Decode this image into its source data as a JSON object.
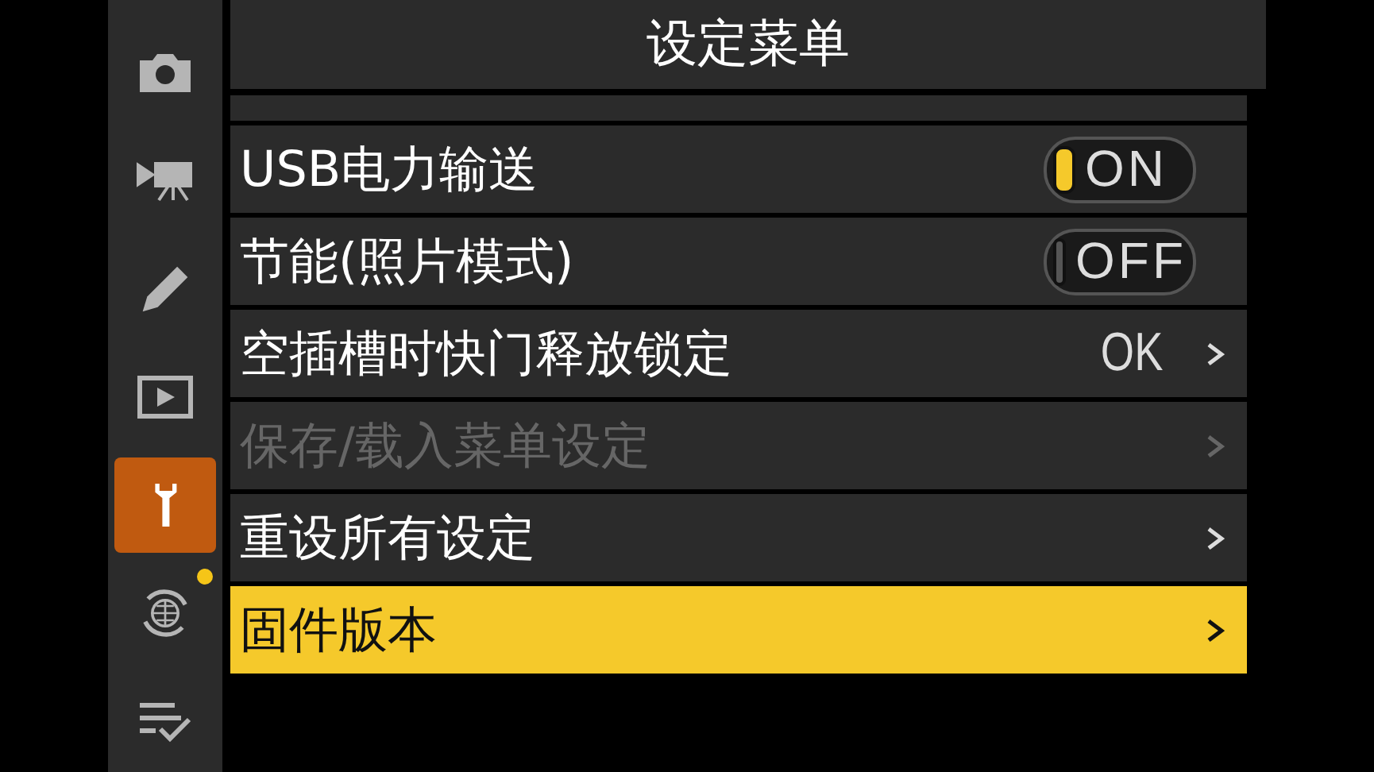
{
  "sidebar": {
    "items": [
      {
        "selected": false,
        "badge": false
      },
      {
        "selected": false,
        "badge": false
      },
      {
        "selected": false,
        "badge": false
      },
      {
        "selected": false,
        "badge": false
      },
      {
        "selected": true,
        "badge": false
      },
      {
        "selected": false,
        "badge": true
      },
      {
        "selected": false,
        "badge": false
      }
    ]
  },
  "title": "设定菜单",
  "menu": {
    "items": [
      {
        "kind": "toggle",
        "label": "USB电力输送",
        "value": "ON",
        "on": true,
        "disabled": false,
        "selected": false
      },
      {
        "kind": "toggle",
        "label": "节能(照片模式)",
        "value": "OFF",
        "on": false,
        "disabled": false,
        "selected": false
      },
      {
        "kind": "value",
        "label": "空插槽时快门释放锁定",
        "value": "OK",
        "disabled": false,
        "selected": false
      },
      {
        "kind": "submenu",
        "label": "保存/载入菜单设定",
        "disabled": true,
        "selected": false
      },
      {
        "kind": "submenu",
        "label": "重设所有设定",
        "disabled": false,
        "selected": false
      },
      {
        "kind": "submenu",
        "label": "固件版本",
        "disabled": false,
        "selected": true
      }
    ]
  }
}
